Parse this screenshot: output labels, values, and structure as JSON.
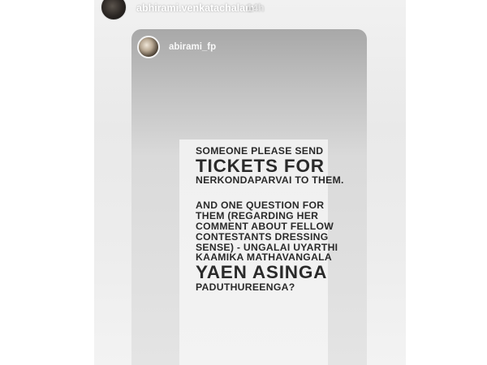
{
  "story": {
    "username": "abhirami.venkatachalam",
    "time": "14h"
  },
  "post": {
    "username": "abirami_fp"
  },
  "note": {
    "line1": "SOMEONE PLEASE SEND",
    "line2": "TICKETS FOR",
    "line3": "NERKONDAPARVAI TO THEM.",
    "line4": "AND ONE QUESTION FOR",
    "line5": "THEM (REGARDING HER",
    "line6": "COMMENT ABOUT FELLOW",
    "line7": "CONTESTANTS DRESSING",
    "line8": "SENSE) - UNGALAI UYARTHI",
    "line9": "KAAMIKA MATHAVANGALA",
    "line10": "YAEN ASINGA",
    "line11": "PADUTHUREENGA?"
  }
}
